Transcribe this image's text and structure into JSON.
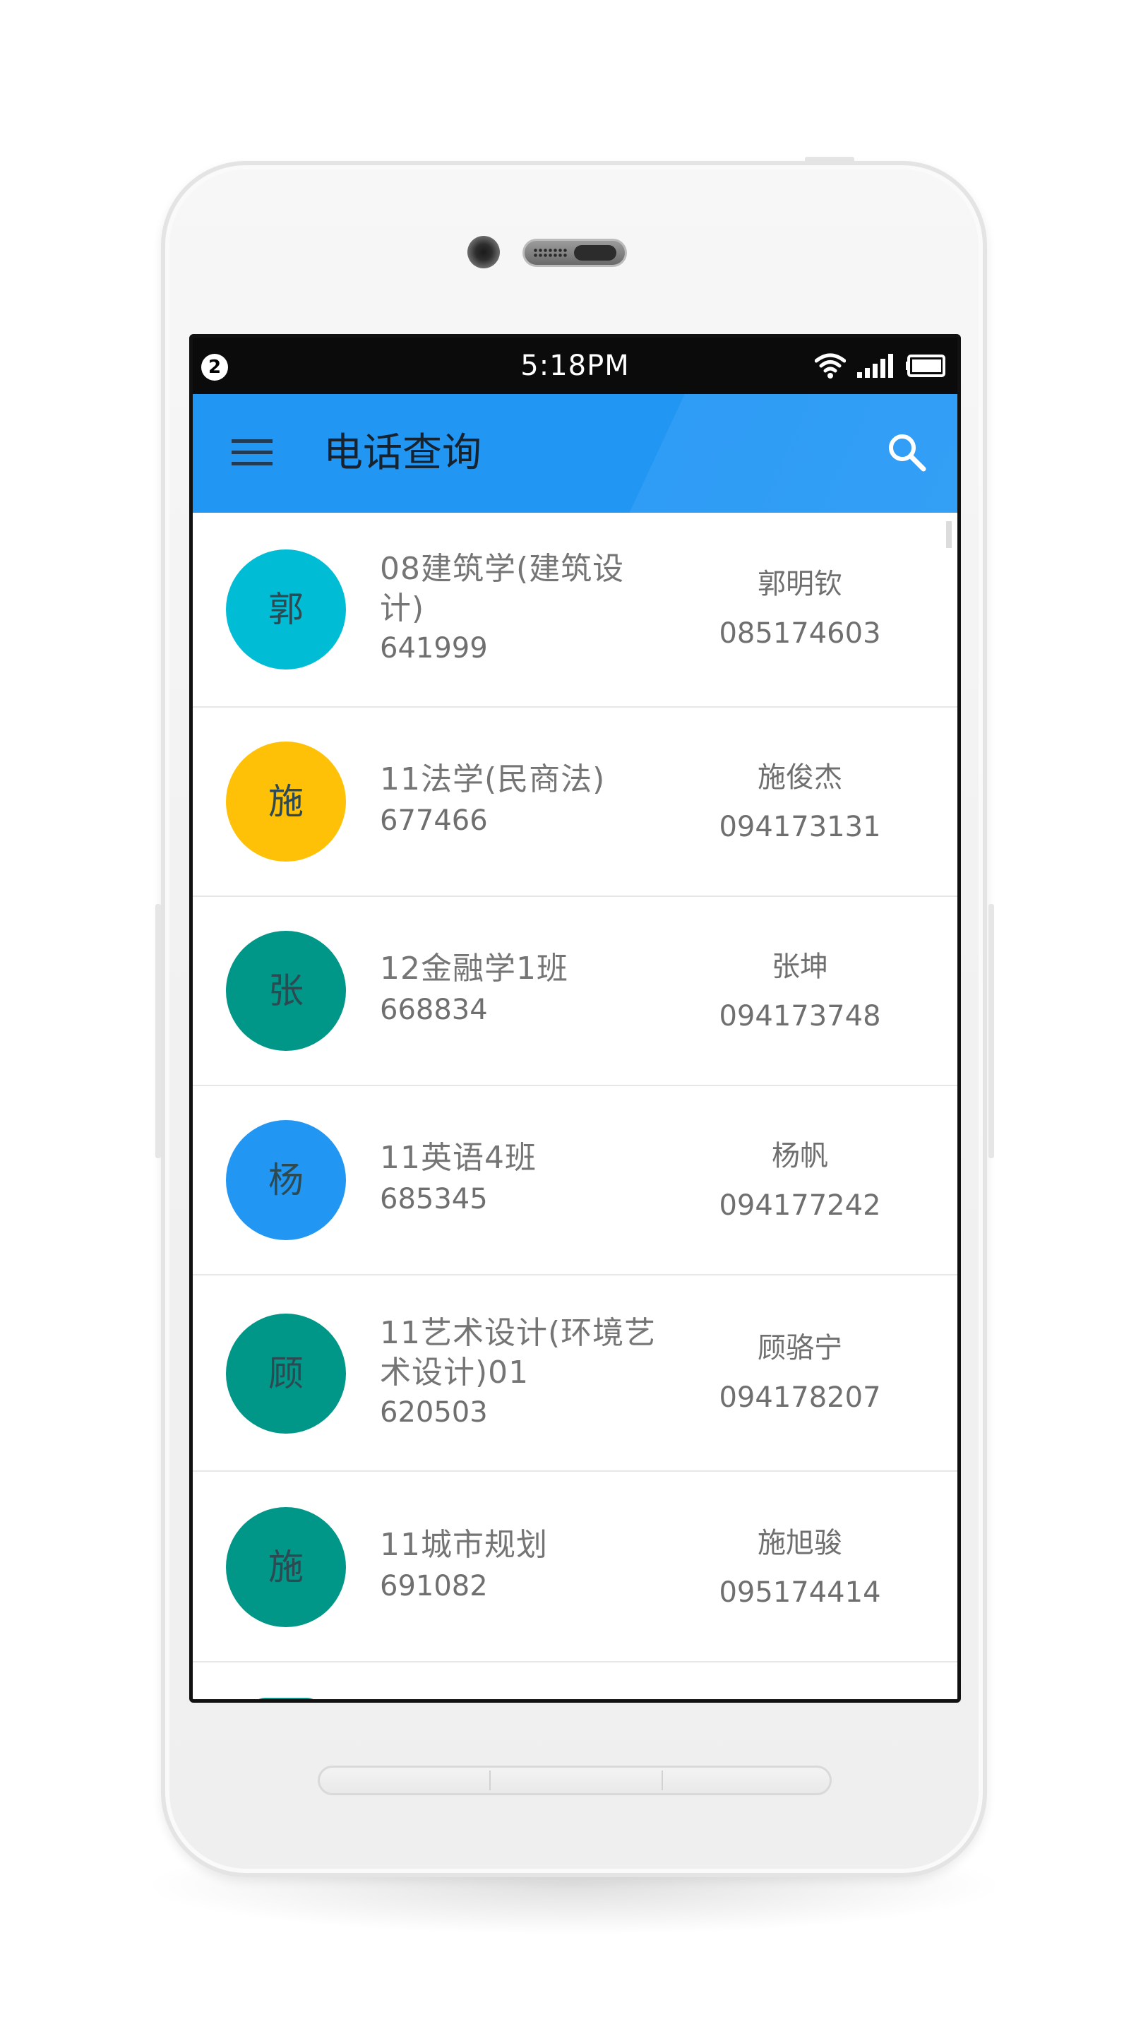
{
  "status_bar": {
    "notification_count": "2",
    "time": "5:18PM",
    "icons": [
      "wifi-icon",
      "signal-icon",
      "battery-icon"
    ]
  },
  "app_bar": {
    "title": "电话查询",
    "menu_icon": "menu-icon",
    "search_icon": "search-icon",
    "color": "#2196f3"
  },
  "contacts": [
    {
      "initial": "郭",
      "class_name": "08建筑学(建筑设计)",
      "room": "641999",
      "name": "郭明钦",
      "phone": "085174603",
      "color": "#00bcd4"
    },
    {
      "initial": "施",
      "class_name": "11法学(民商法)",
      "room": "677466",
      "name": "施俊杰",
      "phone": "094173131",
      "color": "#ffc107"
    },
    {
      "initial": "张",
      "class_name": "12金融学1班",
      "room": "668834",
      "name": "张坤",
      "phone": "094173748",
      "color": "#009688"
    },
    {
      "initial": "杨",
      "class_name": "11英语4班",
      "room": "685345",
      "name": "杨帆",
      "phone": "094177242",
      "color": "#2196f3"
    },
    {
      "initial": "顾",
      "class_name": "11艺术设计(环境艺术设计)01",
      "room": "620503",
      "name": "顾骆宁",
      "phone": "094178207",
      "color": "#009688"
    },
    {
      "initial": "施",
      "class_name": "11城市规划",
      "room": "691082",
      "name": "施旭骏",
      "phone": "095174414",
      "color": "#009688"
    }
  ]
}
